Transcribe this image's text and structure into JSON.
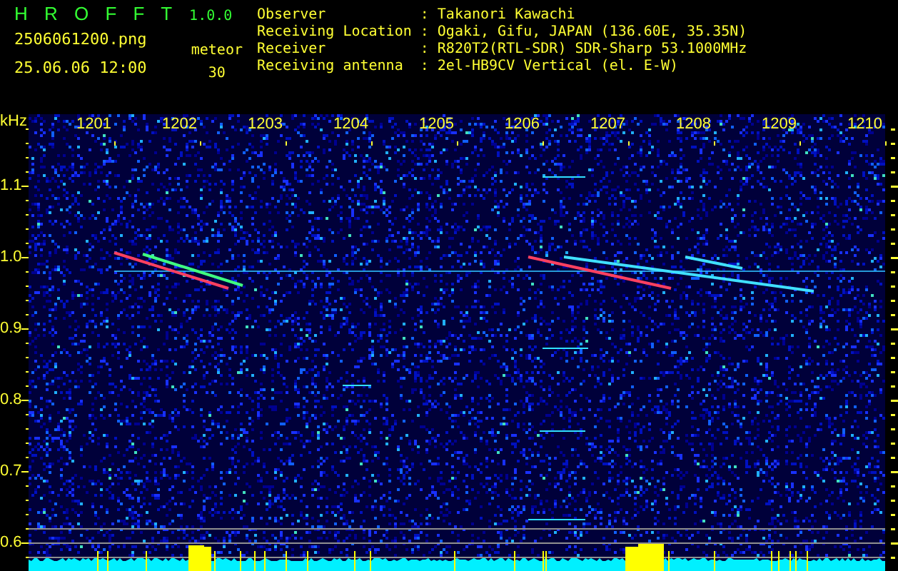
{
  "app": {
    "name": "H R O F F T",
    "version": "1.0.0"
  },
  "file_name": "2506061200.png",
  "timestamp": "25.06.06 12:00",
  "meteor": {
    "label": "meteor",
    "count": "30"
  },
  "info": [
    {
      "label": "Observer",
      "separator": ":",
      "value": "Takanori Kawachi"
    },
    {
      "label": "Receiving Location",
      "separator": ":",
      "value": "Ogaki, Gifu, JAPAN (136.60E, 35.35N)"
    },
    {
      "label": "Receiver",
      "separator": ":",
      "value": "R820T2(RTL-SDR) SDR-Sharp 53.1000MHz"
    },
    {
      "label": "Receiving antenna",
      "separator": ":",
      "value": "2el-HB9CV Vertical (el. E-W)"
    }
  ],
  "spectrogram": {
    "unit": "kHz",
    "x_labels": [
      "1201",
      "1202",
      "1203",
      "1204",
      "1205",
      "1206",
      "1207",
      "1208",
      "1209",
      "1210"
    ],
    "y_labels": [
      "1.1",
      "1.0",
      "0.9",
      "0.8",
      "0.7",
      "0.6"
    ]
  }
}
